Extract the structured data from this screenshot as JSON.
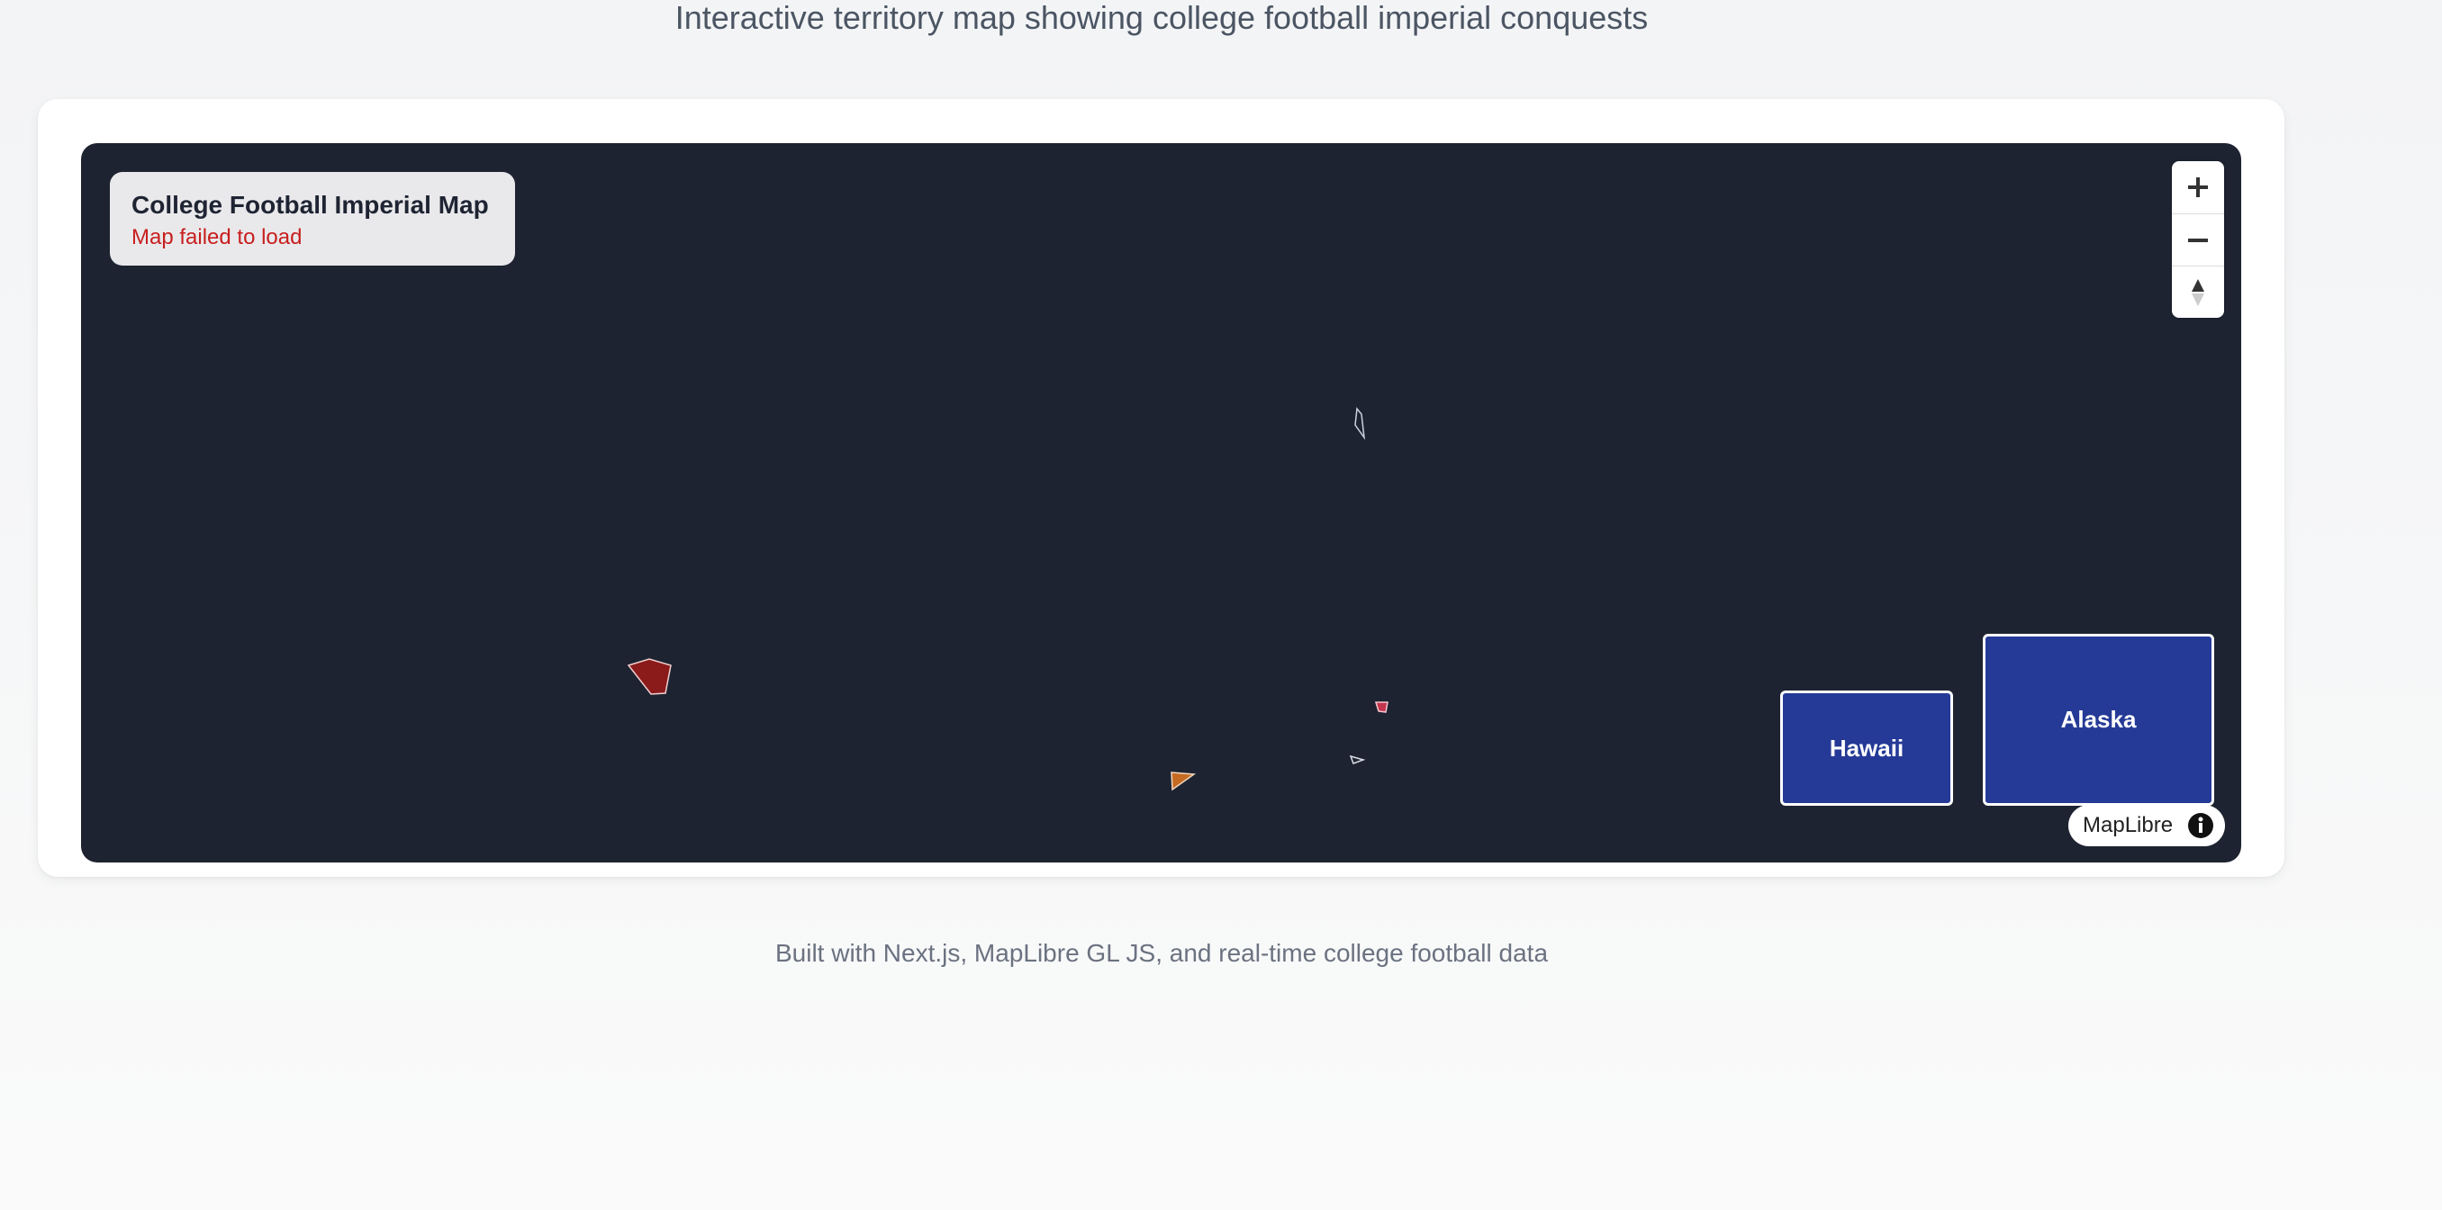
{
  "page": {
    "subtitle": "Interactive territory map showing college football imperial conquests",
    "footer": "Built with Next.js, MapLibre GL JS, and real-time college football data"
  },
  "map": {
    "info_box": {
      "title": "College Football Imperial Map",
      "status": "Map failed to load"
    },
    "controls": {
      "zoom_in_icon": "plus-icon",
      "zoom_out_icon": "minus-icon",
      "compass_icon": "compass-icon"
    },
    "insets": {
      "hawaii": "Hawaii",
      "alaska": "Alaska"
    },
    "attribution": {
      "label": "MapLibre",
      "icon": "info-icon"
    },
    "territories": [
      {
        "id": "territory-red",
        "color": "#8b1a1a"
      },
      {
        "id": "territory-orange",
        "color": "#c46a22"
      },
      {
        "id": "territory-pink",
        "color": "#c4354e"
      },
      {
        "id": "territory-outline-north",
        "color": "#1e2331"
      },
      {
        "id": "territory-small-white",
        "color": "#1e2331"
      }
    ]
  },
  "colors": {
    "map_background": "#1e2331",
    "inset_fill": "#253a96",
    "error_text": "#c81e1e"
  }
}
